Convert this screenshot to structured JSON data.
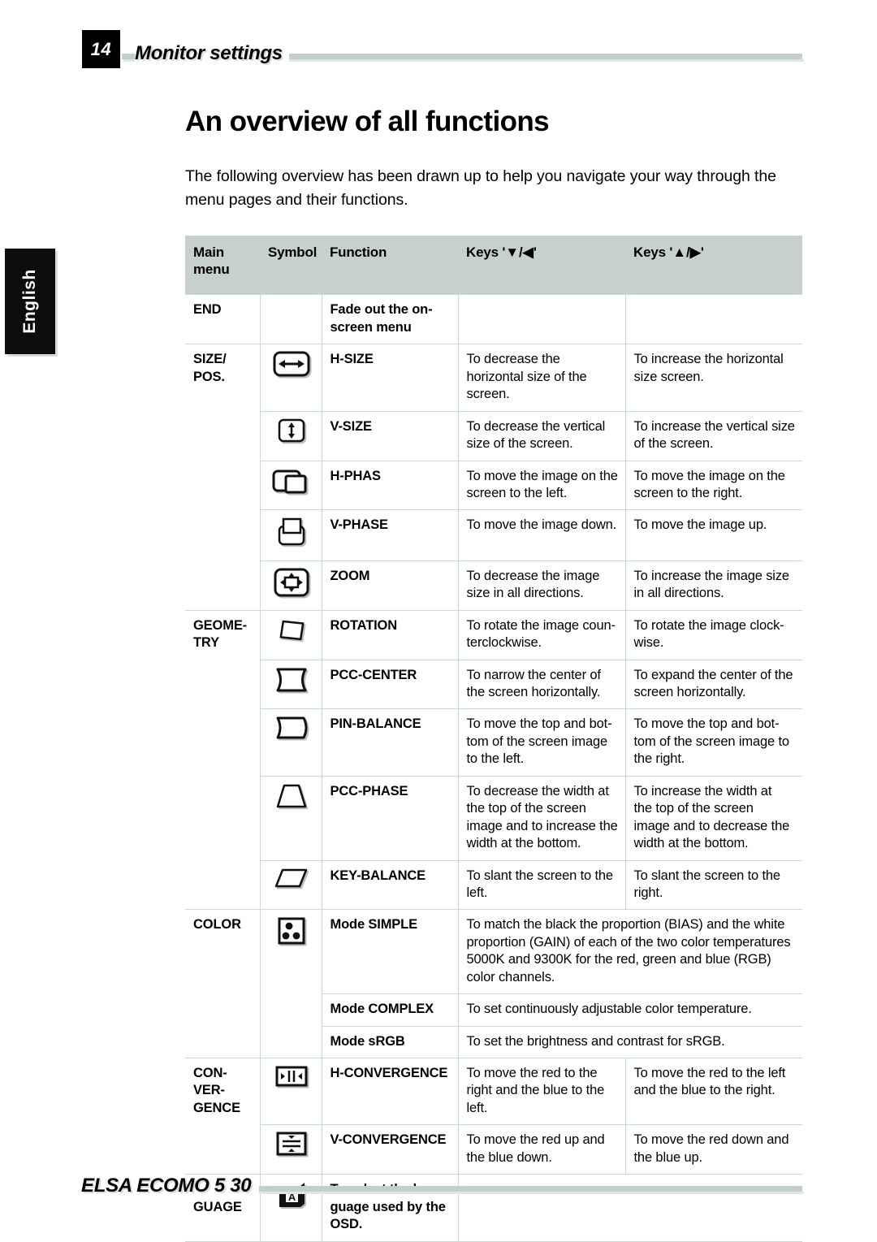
{
  "header": {
    "page_number": "14",
    "running_title": "Monitor settings"
  },
  "side_tab": {
    "label": "English"
  },
  "footer": {
    "product": "ELSA ECOMO 5 30"
  },
  "content": {
    "title": "An overview of all functions",
    "intro": "The following overview has been drawn up to help you navigate your way through the menu pages and their functions."
  },
  "table": {
    "headers": {
      "main_menu": "Main menu",
      "symbol": "Symbol",
      "function": "Function",
      "keys_down": "Keys '▼/◀'",
      "keys_up": "Keys '▲/▶'",
      "keys_down_prefix": "Keys '",
      "keys_down_glyphs": "▼/◀",
      "keys_up_prefix": "Keys '",
      "keys_up_glyphs": "▲/▶",
      "quote": "'"
    },
    "rows": [
      {
        "main_menu": "END",
        "symbol": "",
        "function": "Fade out the on-screen menu",
        "keys_down": "",
        "keys_up": ""
      },
      {
        "main_menu": "SIZE/ POS.",
        "symbol": "h-size-icon",
        "function": "H-SIZE",
        "keys_down": "To decrease the horizontal size of the screen.",
        "keys_up": "To increase the horizontal size screen."
      },
      {
        "main_menu": "",
        "symbol": "v-size-icon",
        "function": "V-SIZE",
        "keys_down": "To decrease the vertical size of the screen.",
        "keys_up": "To increase the vertical size of the screen."
      },
      {
        "main_menu": "",
        "symbol": "h-phase-icon",
        "function": "H-PHAS",
        "keys_down": "To move the image on the screen to the left.",
        "keys_up": "To move the image on the screen to the right."
      },
      {
        "main_menu": "",
        "symbol": "v-phase-icon",
        "function": "V-PHASE",
        "keys_down": "To move the image down.",
        "keys_up": "To move the image up."
      },
      {
        "main_menu": "",
        "symbol": "zoom-icon",
        "function": "ZOOM",
        "keys_down": "To decrease the image size in all directions.",
        "keys_up": "To increase the image size in all directions."
      },
      {
        "main_menu": "GEOME- TRY",
        "symbol": "rotation-icon",
        "function": "ROTATION",
        "keys_down": "To rotate the image counterclockwise.",
        "keys_up": "To rotate the image clockwise."
      },
      {
        "main_menu": "",
        "symbol": "pcc-center-icon",
        "function": "PCC-CENTER",
        "keys_down": "To narrow the center of the screen horizontally.",
        "keys_up": "To expand the center of the screen horizontally."
      },
      {
        "main_menu": "",
        "symbol": "pin-balance-icon",
        "function": "PIN-BALANCE",
        "keys_down": "To move the top and bottom of the screen image to the left.",
        "keys_up": "To move the top and bottom of the screen image to the right."
      },
      {
        "main_menu": "",
        "symbol": "pcc-phase-icon",
        "function": "PCC-PHASE",
        "keys_down": "To decrease the width at the top of the screen image and to increase the width at the bottom.",
        "keys_up": "To increase the width at the top of the screen image and to decrease the width at the bottom."
      },
      {
        "main_menu": "",
        "symbol": "key-balance-icon",
        "function": "KEY-BALANCE",
        "keys_down": "To slant the screen to the left.",
        "keys_up": "To slant the screen to the right."
      },
      {
        "main_menu": "COLOR",
        "symbol": "color-icon",
        "function": "Mode SIMPLE",
        "keys_down": "To match the black the proportion (BIAS) and the white proportion (GAIN) of each of the two color temperatures 5000K and 9300K for the red, green and blue (RGB) color channels.",
        "keys_up": ""
      },
      {
        "main_menu": "",
        "symbol": "",
        "function": "Mode COMPLEX",
        "keys_down": "To set continuously adjustable color temperature.",
        "keys_up": ""
      },
      {
        "main_menu": "",
        "symbol": "",
        "function": "Mode sRGB",
        "keys_down": "To set the brightness and contrast for sRGB.",
        "keys_up": ""
      },
      {
        "main_menu": "CON- VER- GENCE",
        "symbol": "h-convergence-icon",
        "function": "H-CONVERGENCE",
        "keys_down": "To move the red to the right and the blue to the left.",
        "keys_up": "To move the red to the left and the blue to the right."
      },
      {
        "main_menu": "",
        "symbol": "v-convergence-icon",
        "function": "V-CONVERGENCE",
        "keys_down": "To move the red up and the blue down.",
        "keys_up": "To move the red down and the blue up."
      },
      {
        "main_menu": "LAN- GUAGE",
        "symbol": "language-icon",
        "function": "To select the language used by the OSD.",
        "keys_down": "",
        "keys_up": ""
      }
    ]
  },
  "colors": {
    "header_band": "#c6d0ce",
    "rule": "#c3cfcc",
    "grid_line": "#c9dbd9",
    "tab_background": "#0d0d0d",
    "text": "#000000"
  }
}
